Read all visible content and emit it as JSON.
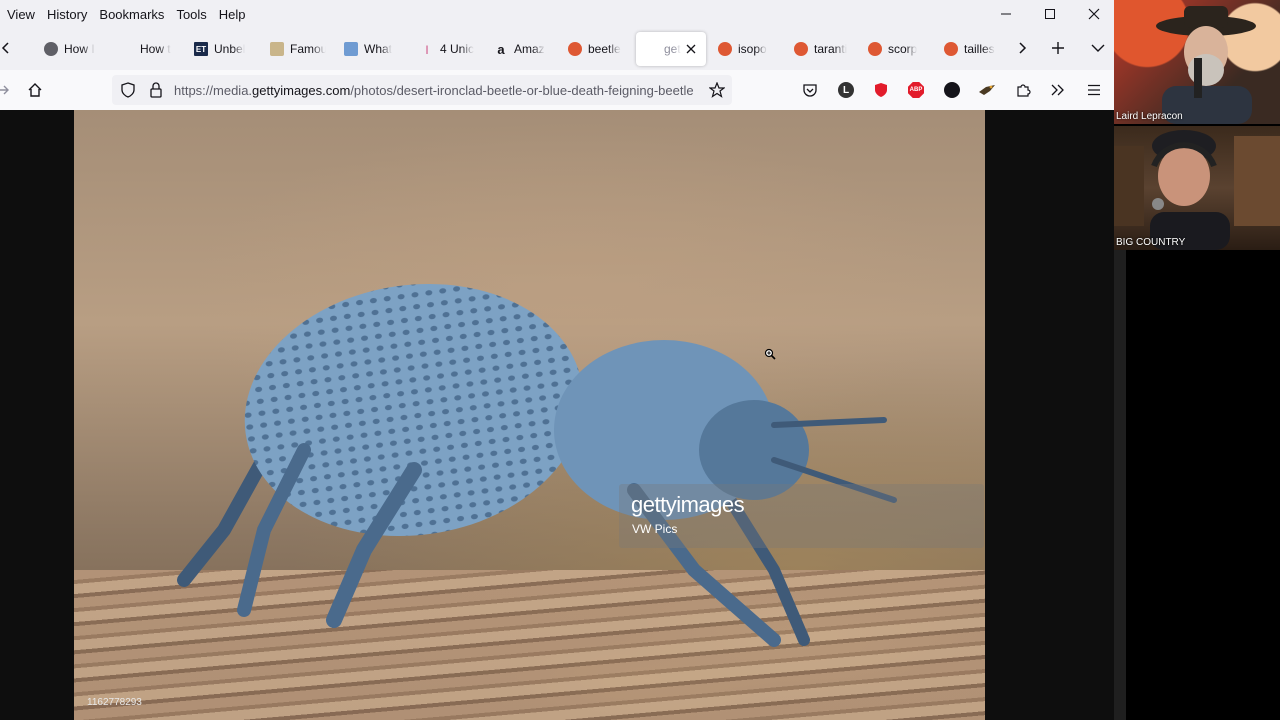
{
  "menubar": {
    "items": [
      "View",
      "History",
      "Bookmarks",
      "Tools",
      "Help"
    ]
  },
  "tabs": [
    {
      "label": "How I",
      "icon": "tool-icon"
    },
    {
      "label": "How t",
      "icon": "blank-page-icon"
    },
    {
      "label": "Unbel",
      "icon": "et-site-icon"
    },
    {
      "label": "Famou",
      "icon": "gem-icon"
    },
    {
      "label": "What",
      "icon": "image-icon"
    },
    {
      "label": "4 Unic",
      "icon": "unicorn-icon"
    },
    {
      "label": "Amaz",
      "icon": "amazon-icon"
    },
    {
      "label": "beetle",
      "icon": "duckduckgo-icon"
    },
    {
      "label": "get",
      "icon": "blank-icon",
      "active": true
    },
    {
      "label": "isopo",
      "icon": "duckduckgo-icon"
    },
    {
      "label": "taranti",
      "icon": "duckduckgo-icon"
    },
    {
      "label": "scorp",
      "icon": "duckduckgo-icon"
    },
    {
      "label": "tailles",
      "icon": "duckduckgo-icon"
    }
  ],
  "address": {
    "prefix": "https://media.",
    "domain": "gettyimages.com",
    "path": "/photos/desert-ironclad-beetle-or-blue-death-feigning-beetle"
  },
  "page": {
    "watermark_brand": "gettyimages",
    "watermark_credit": "VW Pics",
    "image_id": "1162778293"
  },
  "webcams": [
    {
      "name": "Laird Lepracon"
    },
    {
      "name": "BIG COUNTRY"
    }
  ],
  "colors": {
    "chrome_bg": "#f0f0f4",
    "navbar_bg": "#f9f9fb",
    "content_bg": "#0e0e0e",
    "beetle_blue": "#6f94b8",
    "duckduckgo_orange": "#de5833"
  }
}
